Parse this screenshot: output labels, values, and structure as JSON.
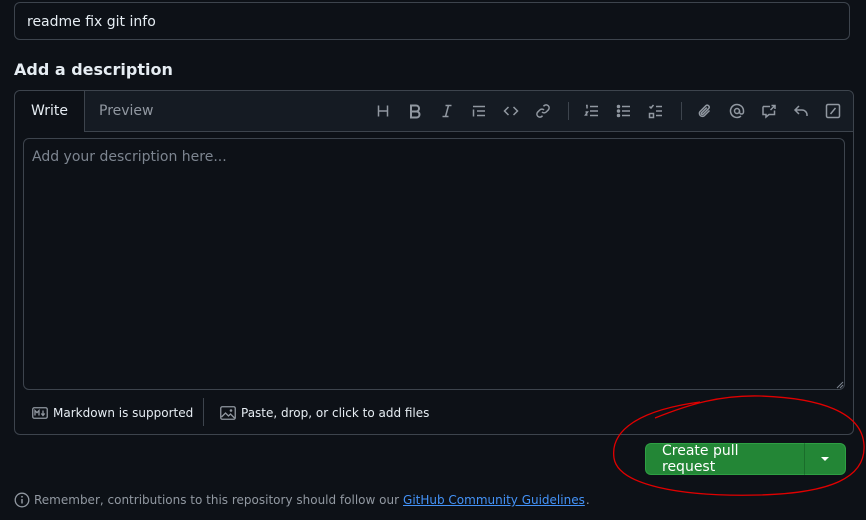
{
  "title_field": {
    "value": "readme fix git info"
  },
  "description": {
    "heading": "Add a description",
    "tabs": [
      "Write",
      "Preview"
    ],
    "toolbar": [
      "heading-icon",
      "bold-icon",
      "italic-icon",
      "quote-icon",
      "code-icon",
      "link-icon",
      "ordered-list-icon",
      "unordered-list-icon",
      "task-list-icon",
      "attach-icon",
      "mention-icon",
      "reference-icon",
      "reply-icon",
      "slash-command-icon"
    ],
    "placeholder": "Add your description here...",
    "footer": {
      "markdown_label": "Markdown is supported",
      "files_label": "Paste, drop, or click to add files"
    }
  },
  "actions": {
    "create_label": "Create pull request",
    "accent": "#238636",
    "annotation_color": "#e00000"
  },
  "guidelines": {
    "prefix": "Remember, contributions to this repository should follow our",
    "link": "GitHub Community Guidelines",
    "suffix": "."
  }
}
